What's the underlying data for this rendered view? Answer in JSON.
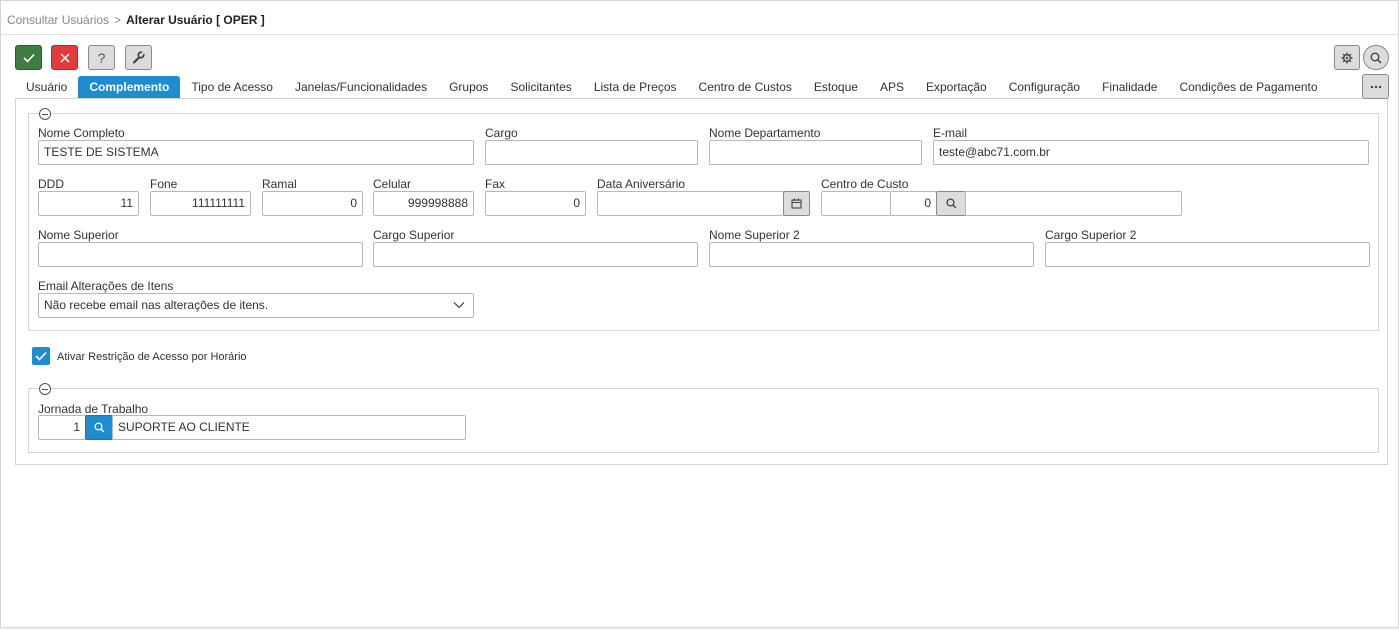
{
  "breadcrumb": {
    "parent": "Consultar Usuários",
    "separator": ">",
    "current": "Alterar Usuário [ OPER ]"
  },
  "toolbar": {
    "help_label": "?"
  },
  "tabs": [
    {
      "label": "Usuário",
      "active": false
    },
    {
      "label": "Complemento",
      "active": true
    },
    {
      "label": "Tipo de Acesso",
      "active": false
    },
    {
      "label": "Janelas/Funcionalidades",
      "active": false
    },
    {
      "label": "Grupos",
      "active": false
    },
    {
      "label": "Solicitantes",
      "active": false
    },
    {
      "label": "Lista de Preços",
      "active": false
    },
    {
      "label": "Centro de Custos",
      "active": false
    },
    {
      "label": "Estoque",
      "active": false
    },
    {
      "label": "APS",
      "active": false
    },
    {
      "label": "Exportação",
      "active": false
    },
    {
      "label": "Configuração",
      "active": false
    },
    {
      "label": "Finalidade",
      "active": false
    },
    {
      "label": "Condições de Pagamento",
      "active": false
    }
  ],
  "form": {
    "nome_completo": {
      "label": "Nome Completo",
      "value": "TESTE DE SISTEMA"
    },
    "cargo": {
      "label": "Cargo",
      "value": ""
    },
    "nome_departamento": {
      "label": "Nome Departamento",
      "value": ""
    },
    "email": {
      "label": "E-mail",
      "value": "teste@abc71.com.br"
    },
    "ddd": {
      "label": "DDD",
      "value": "11"
    },
    "fone": {
      "label": "Fone",
      "value": "111111111"
    },
    "ramal": {
      "label": "Ramal",
      "value": "0"
    },
    "celular": {
      "label": "Celular",
      "value": "999998888"
    },
    "fax": {
      "label": "Fax",
      "value": "0"
    },
    "data_aniversario": {
      "label": "Data Aniversário",
      "value": ""
    },
    "centro_custo": {
      "label": "Centro de Custo",
      "code1": "",
      "code2": "0",
      "description": ""
    },
    "nome_superior": {
      "label": "Nome Superior",
      "value": ""
    },
    "cargo_superior": {
      "label": "Cargo Superior",
      "value": ""
    },
    "nome_superior_2": {
      "label": "Nome Superior 2",
      "value": ""
    },
    "cargo_superior_2": {
      "label": "Cargo Superior 2",
      "value": ""
    },
    "email_alteracoes": {
      "label": "Email Alterações de Itens",
      "value": "Não recebe email nas alterações de itens."
    }
  },
  "restricao": {
    "label": "Ativar Restrição de Acesso por Horário",
    "checked": true
  },
  "jornada": {
    "label": "Jornada de Trabalho",
    "code": "1",
    "description": "SUPORTE AO CLIENTE"
  },
  "colors": {
    "accent": "#1f8ccf",
    "ok": "#3d7d44",
    "cancel": "#e23b3b"
  },
  "icons": [
    "check-icon",
    "close-icon",
    "help-icon",
    "wrench-icon",
    "gear-icon",
    "search-icon",
    "more-icon",
    "calendar-icon",
    "chevron-down-icon",
    "collapse-icon"
  ]
}
